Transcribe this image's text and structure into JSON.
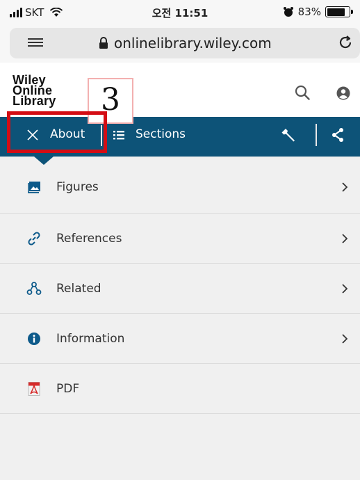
{
  "status_bar": {
    "carrier": "SKT",
    "time": "오전 11:51",
    "battery_percent": "83%",
    "battery_level": 0.83
  },
  "browser": {
    "url": "onlinelibrary.wiley.com"
  },
  "site": {
    "logo_lines": [
      "Wiley",
      "Online",
      "Library"
    ]
  },
  "annotation": {
    "label": "3"
  },
  "nav": {
    "about_label": "About",
    "sections_label": "Sections"
  },
  "menu": {
    "items": [
      {
        "label": "Figures",
        "icon": "image-icon",
        "has_chevron": true
      },
      {
        "label": "References",
        "icon": "link-icon",
        "has_chevron": true
      },
      {
        "label": "Related",
        "icon": "network-icon",
        "has_chevron": true
      },
      {
        "label": "Information",
        "icon": "info-icon",
        "has_chevron": true
      },
      {
        "label": "PDF",
        "icon": "pdf-icon",
        "has_chevron": false
      }
    ]
  },
  "colors": {
    "nav_background": "#0d5378",
    "icon_blue": "#0d5a8a",
    "pdf_red": "#d62a2a",
    "annotation_red": "#d40d14"
  }
}
